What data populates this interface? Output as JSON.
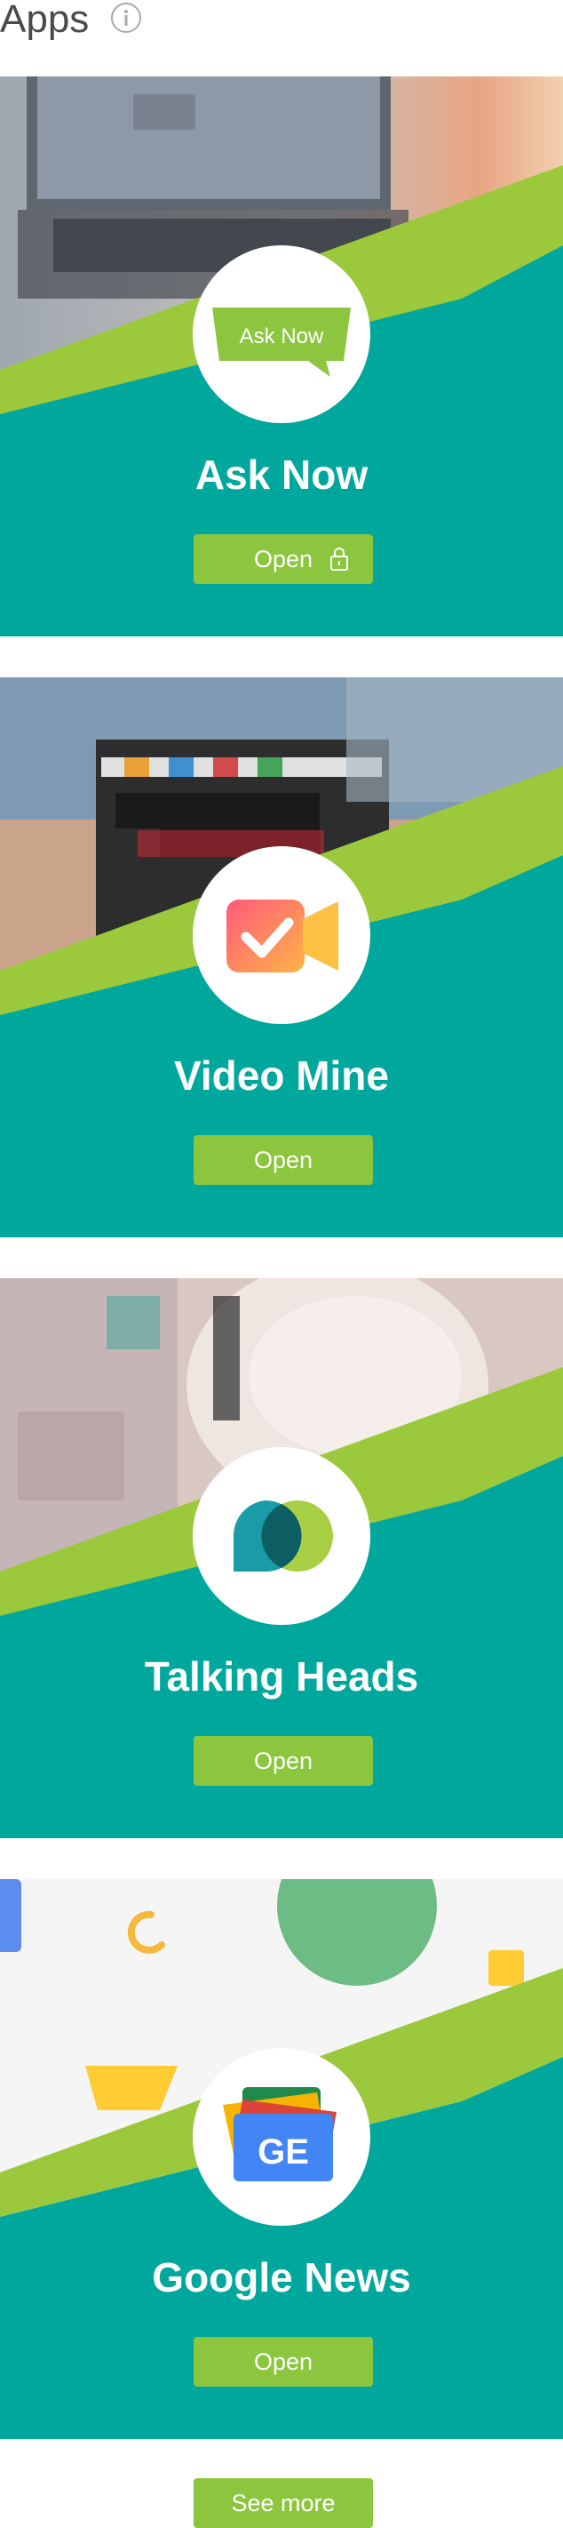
{
  "header": {
    "title": "Apps",
    "info_icon": "info-circle-icon"
  },
  "apps": [
    {
      "title": "Ask Now",
      "logo_text": "Ask Now",
      "button": "Open",
      "locked": true,
      "icon": "speech-bubble-icon"
    },
    {
      "title": "Video Mine",
      "button": "Open",
      "locked": false,
      "icon": "video-check-icon"
    },
    {
      "title": "Talking Heads",
      "button": "Open",
      "locked": false,
      "icon": "overlapping-bubbles-icon"
    },
    {
      "title": "Google News",
      "logo_text": "GE",
      "button": "Open",
      "locked": false,
      "icon": "google-news-icon"
    }
  ],
  "see_more": "See more",
  "colors": {
    "teal": "#00a79d",
    "green": "#8cc63f",
    "lime": "#9bc93b"
  }
}
